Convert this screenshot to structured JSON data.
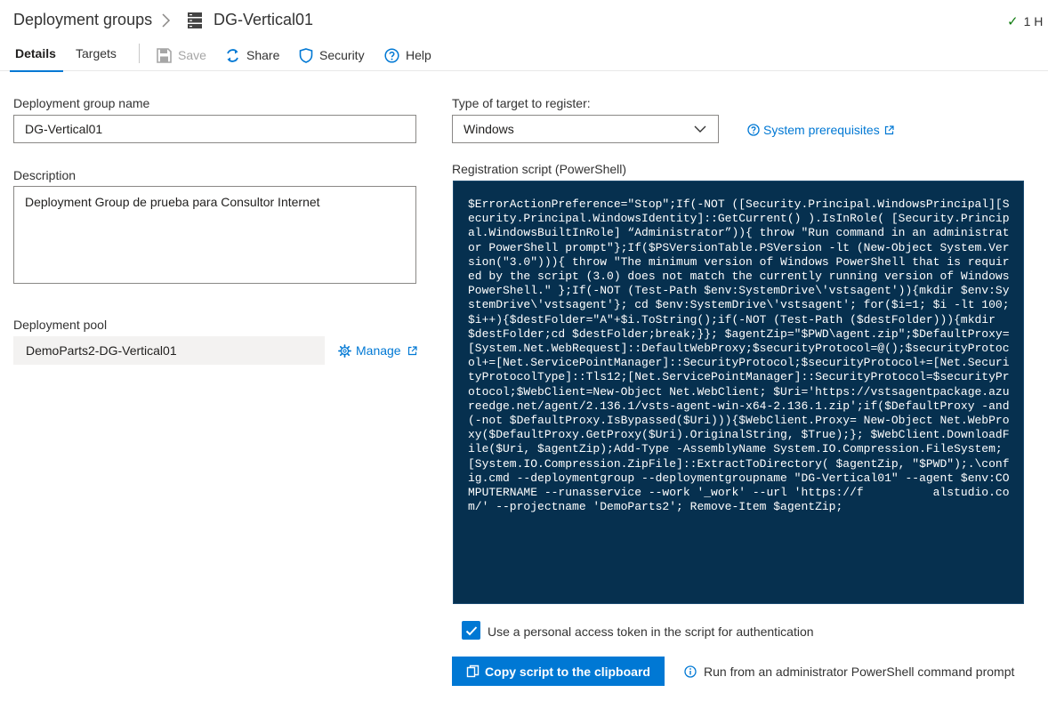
{
  "breadcrumb": {
    "root": "Deployment groups",
    "current": "DG-Vertical01"
  },
  "status": {
    "text": "1 H",
    "color": "#107c10"
  },
  "tabs": [
    {
      "label": "Details",
      "active": true
    },
    {
      "label": "Targets",
      "active": false
    }
  ],
  "toolbar": {
    "save_label": "Save",
    "share_label": "Share",
    "security_label": "Security",
    "help_label": "Help"
  },
  "form": {
    "name_label": "Deployment group name",
    "name_value": "DG-Vertical01",
    "description_label": "Description",
    "description_value": "Deployment Group de prueba para Consultor Internet",
    "pool_label": "Deployment pool",
    "pool_value": "DemoParts2-DG-Vertical01",
    "manage_label": "Manage"
  },
  "target": {
    "type_label": "Type of target to register:",
    "type_value": "Windows",
    "prereq_label": "System prerequisites"
  },
  "script": {
    "label": "Registration script (PowerShell)",
    "text": "$ErrorActionPreference=\"Stop\";If(-NOT ([Security.Principal.WindowsPrincipal][Security.Principal.WindowsIdentity]::GetCurrent() ).IsInRole( [Security.Principal.WindowsBuiltInRole] “Administrator”)){ throw \"Run command in an administrator PowerShell prompt\"};If($PSVersionTable.PSVersion -lt (New-Object System.Version(\"3.0\"))){ throw \"The minimum version of Windows PowerShell that is required by the script (3.0) does not match the currently running version of Windows PowerShell.\" };If(-NOT (Test-Path $env:SystemDrive\\'vstsagent')){mkdir $env:SystemDrive\\'vstsagent'}; cd $env:SystemDrive\\'vstsagent'; for($i=1; $i -lt 100; $i++){$destFolder=\"A\"+$i.ToString();if(-NOT (Test-Path ($destFolder))){mkdir $destFolder;cd $destFolder;break;}}; $agentZip=\"$PWD\\agent.zip\";$DefaultProxy=[System.Net.WebRequest]::DefaultWebProxy;$securityProtocol=@();$securityProtocol+=[Net.ServicePointManager]::SecurityProtocol;$securityProtocol+=[Net.SecurityProtocolType]::Tls12;[Net.ServicePointManager]::SecurityProtocol=$securityProtocol;$WebClient=New-Object Net.WebClient; $Uri='https://vstsagentpackage.azureedge.net/agent/2.136.1/vsts-agent-win-x64-2.136.1.zip';if($DefaultProxy -and (-not $DefaultProxy.IsBypassed($Uri))){$WebClient.Proxy= New-Object Net.WebProxy($DefaultProxy.GetProxy($Uri).OriginalString, $True);}; $WebClient.DownloadFile($Uri, $agentZip);Add-Type -AssemblyName System.IO.Compression.FileSystem;[System.IO.Compression.ZipFile]::ExtractToDirectory( $agentZip, \"$PWD\");.\\config.cmd --deploymentgroup --deploymentgroupname \"DG-Vertical01\" --agent $env:COMPUTERNAME --runasservice --work '_work' --url 'https://f          alstudio.com/' --projectname 'DemoParts2'; Remove-Item $agentZip;",
    "bg_color": "#06304f"
  },
  "pat": {
    "label": "Use a personal access token in the script for authentication",
    "checked": true
  },
  "copy_button_label": "Copy script to the clipboard",
  "info_text": "Run from an administrator PowerShell command prompt",
  "colors": {
    "accent": "#0078d4",
    "success": "#107c10"
  }
}
